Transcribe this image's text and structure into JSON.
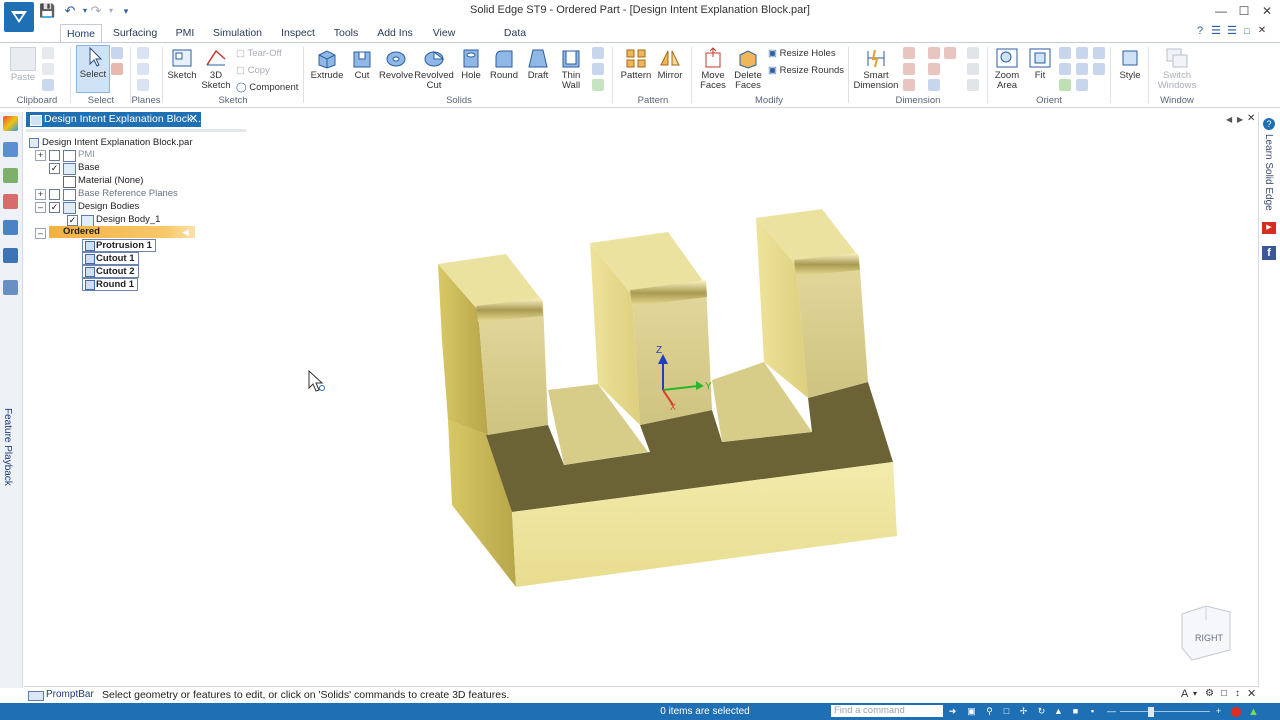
{
  "window": {
    "title": "Solid Edge ST9 - Ordered Part - [Design Intent Explanation Block.par]"
  },
  "tabs": [
    {
      "label": "Home"
    },
    {
      "label": "Surfacing"
    },
    {
      "label": "PMI"
    },
    {
      "label": "Simulation"
    },
    {
      "label": "Inspect"
    },
    {
      "label": "Tools"
    },
    {
      "label": "Add Ins"
    },
    {
      "label": "View"
    },
    {
      "label": "Data Management"
    }
  ],
  "ribbon": {
    "clipboard": {
      "paste": "Paste",
      "group": "Clipboard"
    },
    "select": {
      "label": "Select",
      "group": "Select"
    },
    "planes": {
      "group": "Planes"
    },
    "sketch": {
      "sketch": "Sketch",
      "sketch3d_a": "3D",
      "sketch3d_b": "Sketch",
      "tearoff": "Tear-Off",
      "copy": "Copy",
      "component": "Component",
      "group": "Sketch"
    },
    "solids": {
      "extrude": "Extrude",
      "cut": "Cut",
      "revolve": "Revolve",
      "revolved_cut_a": "Revolved",
      "revolved_cut_b": "Cut",
      "hole": "Hole",
      "round": "Round",
      "draft": "Draft",
      "thin_wall_a": "Thin",
      "thin_wall_b": "Wall",
      "group": "Solids"
    },
    "pattern": {
      "pattern": "Pattern",
      "mirror": "Mirror",
      "group": "Pattern"
    },
    "modify": {
      "move_faces_a": "Move",
      "move_faces_b": "Faces",
      "delete_faces_a": "Delete",
      "delete_faces_b": "Faces",
      "resize_holes": "Resize Holes",
      "resize_rounds": "Resize Rounds",
      "group": "Modify"
    },
    "dimension": {
      "smart_a": "Smart",
      "smart_b": "Dimension",
      "group": "Dimension"
    },
    "orient": {
      "zoom_a": "Zoom",
      "zoom_b": "Area",
      "fit": "Fit",
      "group": "Orient"
    },
    "style": {
      "label": "Style"
    },
    "window": {
      "switch_a": "Switch",
      "switch_b": "Windows",
      "group": "Window"
    }
  },
  "doc_tab": {
    "label": "Design Intent Explanation Block..."
  },
  "tree": {
    "root": "Design Intent Explanation Block.par",
    "pmi": "PMI",
    "base": "Base",
    "material": "Material (None)",
    "base_ref": "Base Reference Planes",
    "design_bodies": "Design Bodies",
    "design_body_1": "Design Body_1",
    "ordered": "Ordered",
    "features": [
      {
        "label": "Protrusion 1"
      },
      {
        "label": "Cutout 1"
      },
      {
        "label": "Cutout 2"
      },
      {
        "label": "Round 1"
      }
    ]
  },
  "left_panel": {
    "feature_playback": "Feature Playback"
  },
  "right_panel": {
    "learn": "Learn Solid Edge"
  },
  "viewport": {
    "axis_x": "X",
    "axis_y": "Y",
    "axis_z": "Z",
    "view_cube": "RIGHT"
  },
  "prompt": {
    "label": "PromptBar",
    "text": "Select geometry or features to edit, or click on 'Solids' commands to create 3D features."
  },
  "status": {
    "selection": "0 items are selected",
    "find_placeholder": "Find a command"
  },
  "colors": {
    "accent": "#1f6fb5",
    "ordered_highlight": "#f7b84b",
    "model_light": "#efe6a0",
    "model_dark": "#6e6538"
  }
}
